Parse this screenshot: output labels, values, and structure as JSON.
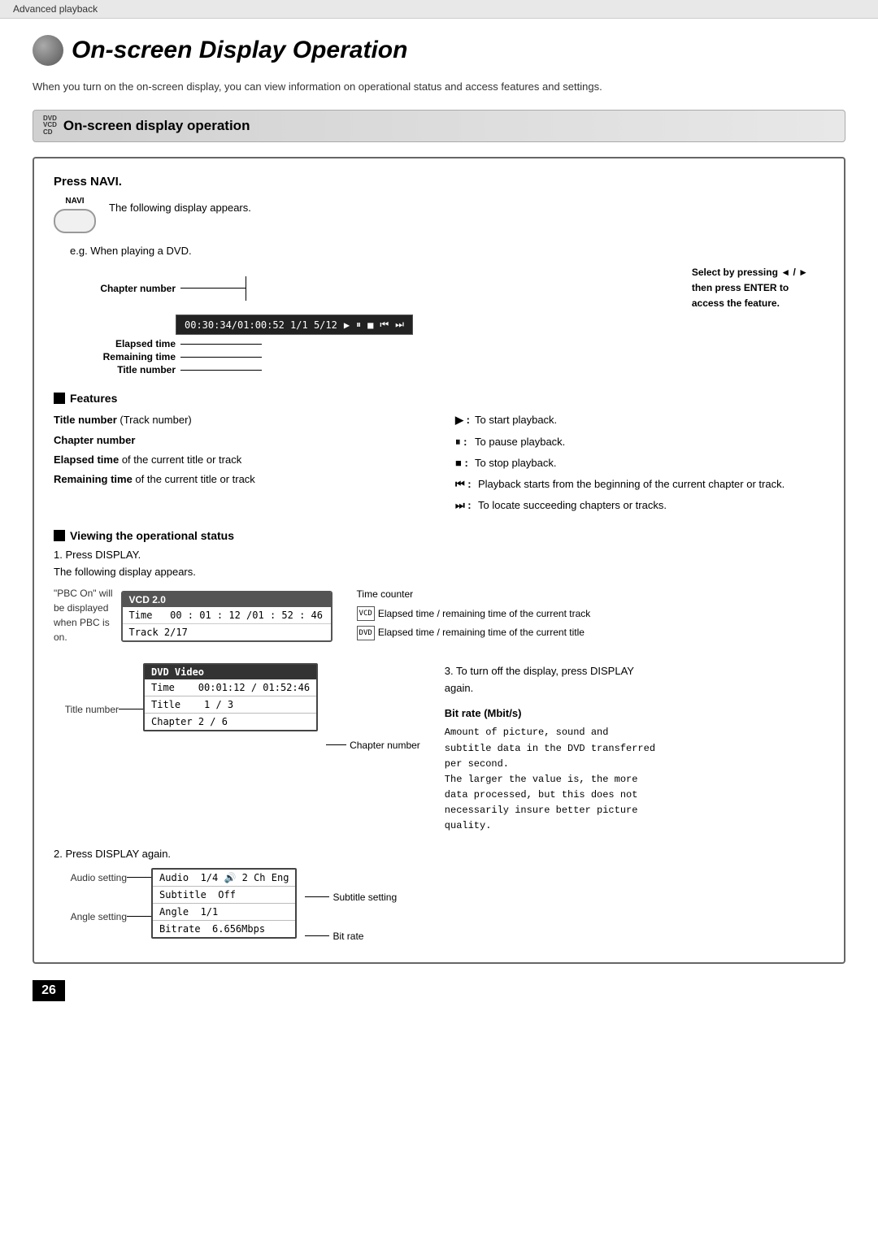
{
  "topbar": {
    "label": "Advanced playback"
  },
  "page": {
    "title": "On-screen Display Operation",
    "description": "When you turn on the on-screen display, you can view information on operational status and access features and settings.",
    "page_number": "26"
  },
  "section_header": {
    "icons": [
      "DVD",
      "VCD",
      "CD"
    ],
    "title": "On-screen display operation"
  },
  "press_navi": {
    "title": "Press NAVI.",
    "navi_label": "NAVI",
    "description": "The following display appears.",
    "example_label": "e.g. When playing a DVD.",
    "osd_timecode": "00:30:34/01:00:52  1/1  5/12",
    "osd_controls": [
      "▶",
      "⏸",
      "■",
      "⏮",
      "⏭"
    ],
    "chapter_number_label": "Chapter number",
    "elapsed_time_label": "Elapsed time",
    "remaining_time_label": "Remaining time",
    "title_number_label": "Title number",
    "select_note": "Select by pressing ◄ / ►",
    "then_press_note": "then press ENTER to",
    "access_note": "access the feature."
  },
  "features": {
    "header": "Features",
    "items_left": [
      {
        "bold": "Title number",
        "normal": " (Track number)"
      },
      {
        "bold": "Chapter number",
        "normal": ""
      },
      {
        "bold": "Elapsed time",
        "normal": " of the current title or track"
      },
      {
        "bold": "Remaining time",
        "normal": " of the current title or track"
      }
    ],
    "items_right": [
      {
        "icon": "▶",
        "text": "To start playback."
      },
      {
        "icon": "⏸",
        "text": "To pause playback."
      },
      {
        "icon": "■",
        "text": "To stop playback."
      },
      {
        "icon": "⏮",
        "text": "Playback starts from the beginning of the current chapter or track."
      },
      {
        "icon": "⏭",
        "text": "To locate succeeding chapters or tracks."
      }
    ]
  },
  "viewing": {
    "header": "Viewing the operational status",
    "step1": "1.  Press DISPLAY.",
    "step1_sub": "The following display appears.",
    "vcd_header": "VCD 2.0",
    "vcd_rows": [
      {
        "label": "Time",
        "value": "00 : 01 : 12 /01 : 52 : 46"
      },
      {
        "label": "Track",
        "value": "2/17"
      }
    ],
    "pbc_note": "\"PBC On\" will\nbe displayed\nwhen PBC is\non.",
    "time_counter_label": "Time counter",
    "vcd_elapsed_note": "Elapsed time / remaining time of the current track",
    "dvd_elapsed_note": "Elapsed time / remaining time of the current title",
    "dvd_header": "DVD Video",
    "dvd_rows": [
      {
        "label": "Time",
        "value": "00:01:12 / 01:52:46"
      },
      {
        "label": "Title",
        "value": "1 / 3"
      },
      {
        "label": "Chapter",
        "value": "2 / 6"
      }
    ],
    "title_number_label": "Title  number",
    "chapter_number_label": "Chapter number",
    "step3_note": "3.  To turn off the display, press DISPLAY again.",
    "bitrate_title": "Bit rate (Mbit/s)",
    "bitrate_desc": "Amount of picture, sound and subtitle data in the DVD transferred per second.\nThe larger the value is, the more data processed, but this does not necessarily insure better picture quality."
  },
  "display_again": {
    "step2": "2.  Press DISPLAY again.",
    "audio_label": "Audio setting",
    "angle_label": "Angle setting",
    "subtitle_setting_label": "Subtitle setting",
    "bitrate_label": "Bit rate",
    "rows": [
      {
        "label": "Audio",
        "value": "1/4  🔊  2 Ch  Eng"
      },
      {
        "label": "Subtitle",
        "value": "Off"
      },
      {
        "label": "Angle",
        "value": "1/1"
      },
      {
        "label": "Bitrate",
        "value": "6.656Mbps"
      }
    ]
  }
}
